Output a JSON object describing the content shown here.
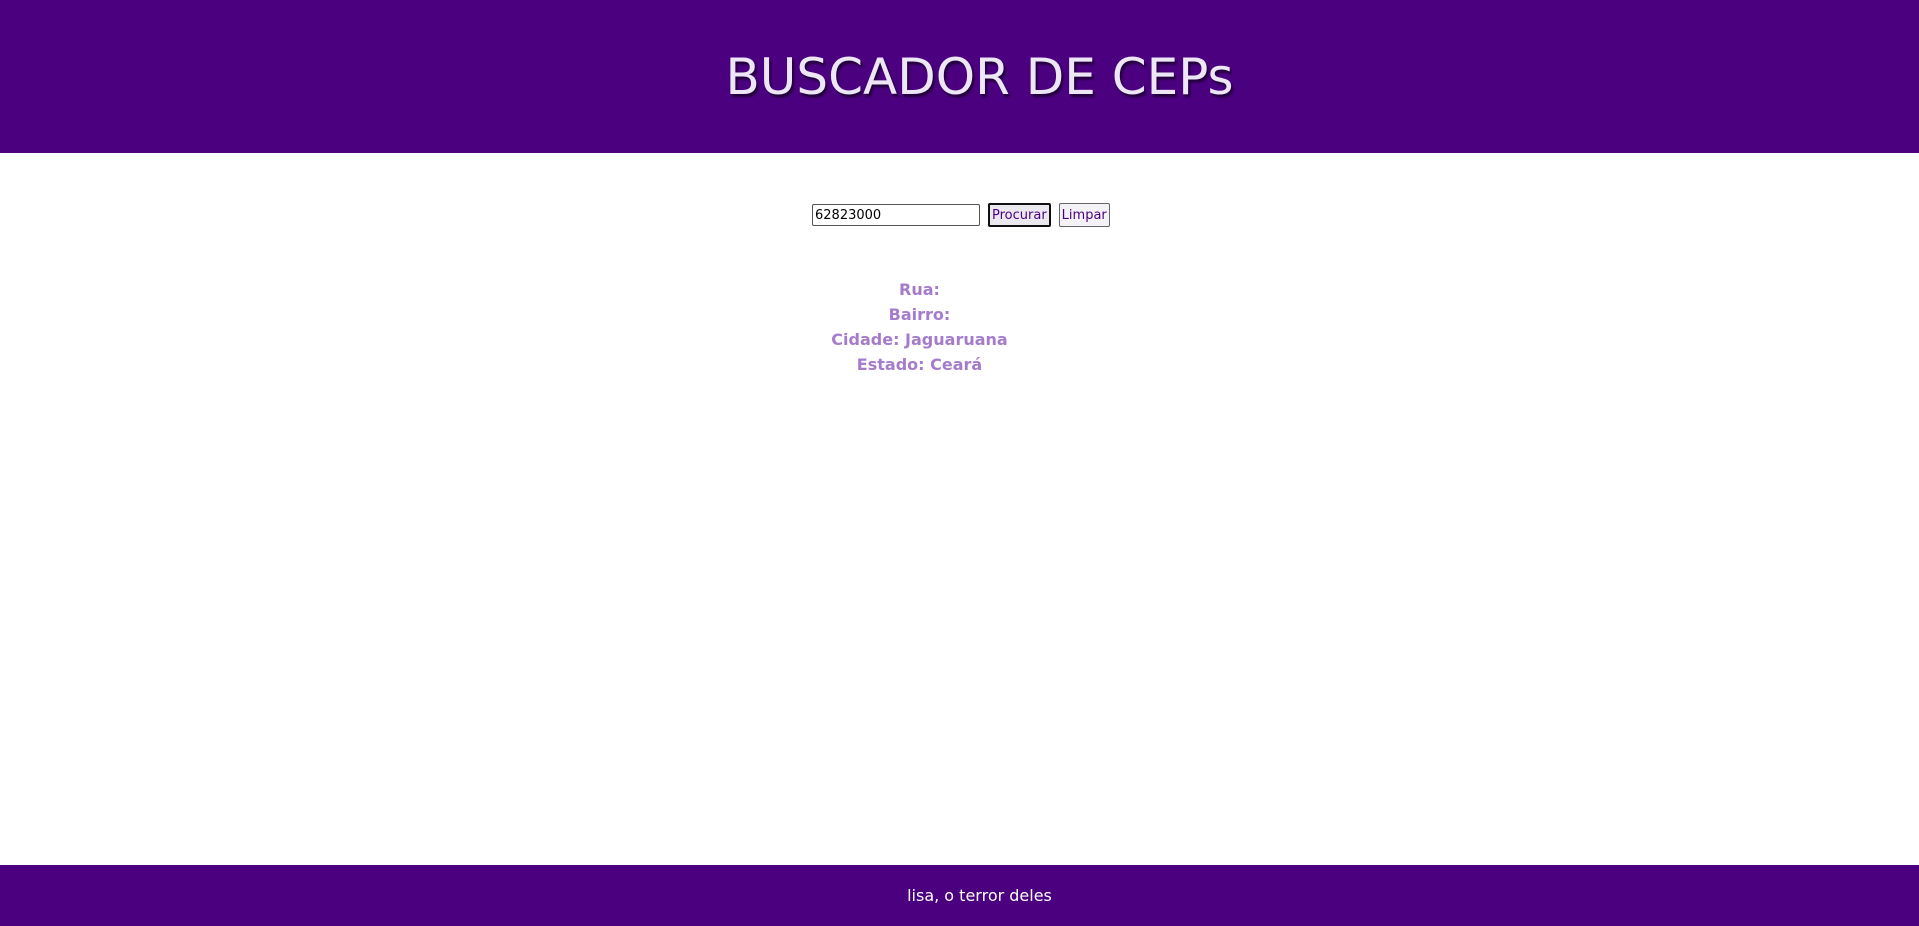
{
  "header": {
    "title": "BUSCADOR DE CEPs"
  },
  "search": {
    "cep_value": "62823000",
    "search_button_label": "Procurar",
    "clear_button_label": "Limpar"
  },
  "results": {
    "rua": "Rua: ",
    "bairro": "Bairro: ",
    "cidade": "Cidade: Jaguaruana",
    "estado": "Estado: Ceará"
  },
  "footer": {
    "text": "lisa, o terror deles"
  },
  "colors": {
    "brand_purple": "#4b0080",
    "result_text": "#a57ccc",
    "title_text": "#ece6f5"
  }
}
